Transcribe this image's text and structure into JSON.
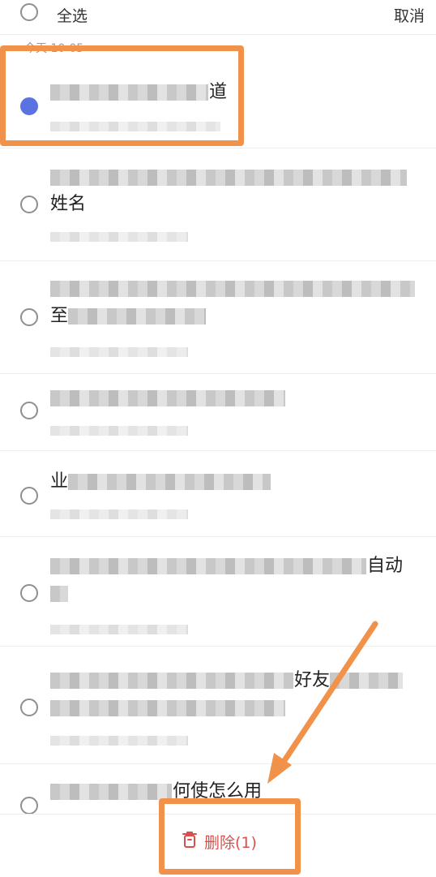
{
  "header": {
    "select_all_label": "全选",
    "cancel_label": "取消"
  },
  "list": {
    "group_date": "今天 10-05",
    "items": [
      {
        "checked": true,
        "title_visible": "道"
      },
      {
        "checked": false,
        "title_visible": "姓名"
      },
      {
        "checked": false,
        "title_visible": "至"
      },
      {
        "checked": false,
        "title_visible": ""
      },
      {
        "checked": false,
        "title_visible": "业"
      },
      {
        "checked": false,
        "title_visible": "自动"
      },
      {
        "checked": false,
        "title_visible": "好友"
      },
      {
        "checked": false,
        "title_visible": "何使怎么用"
      }
    ]
  },
  "footer": {
    "delete_label": "删除(1)"
  },
  "colors": {
    "accent": "#5b73e0",
    "danger": "#d94f4b",
    "annotation": "#f0924a"
  },
  "icons": {
    "delete": "trash-icon"
  }
}
